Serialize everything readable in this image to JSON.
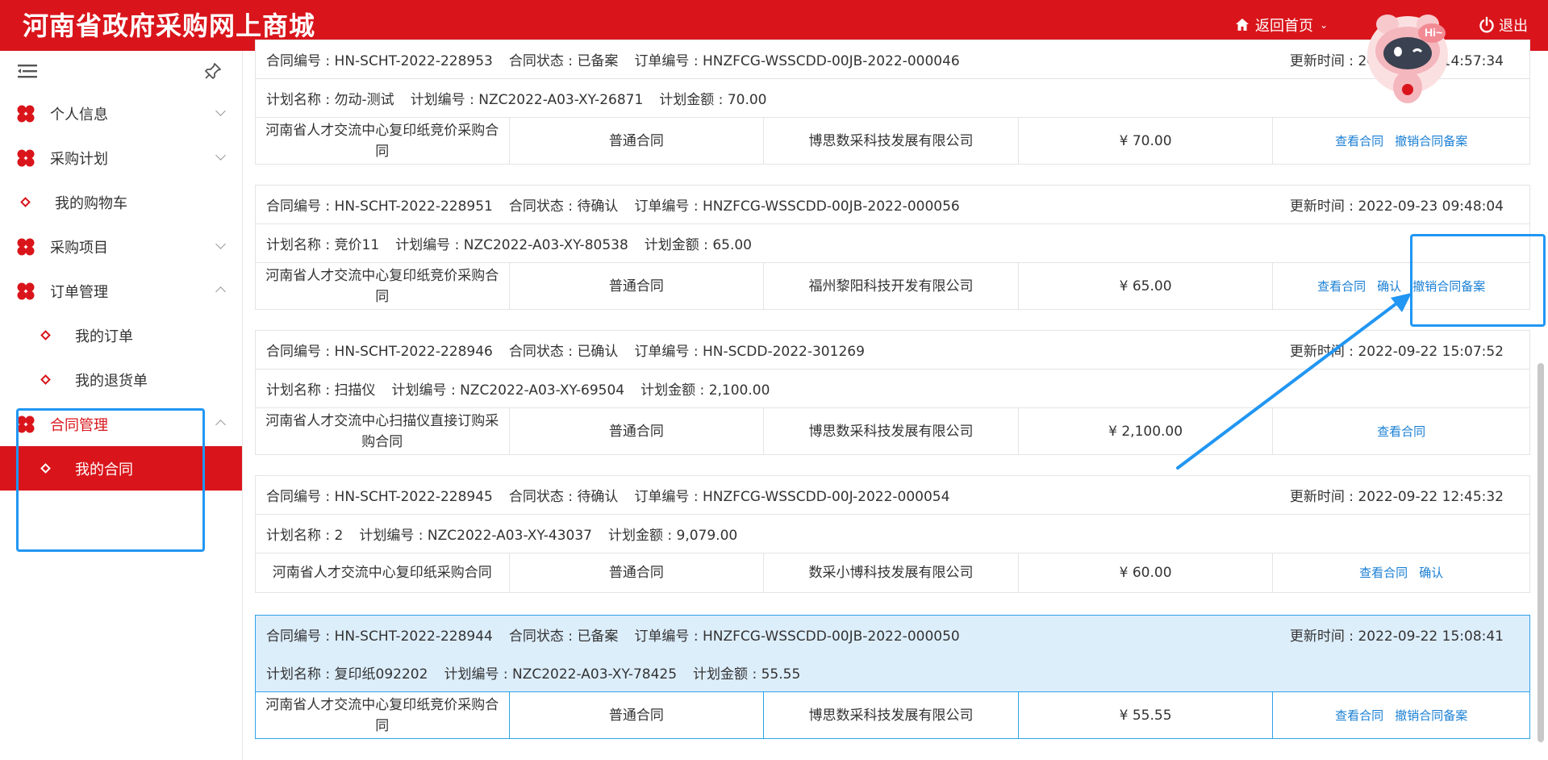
{
  "header": {
    "brand": "河南省政府采购网上商城",
    "home_label": "返回首页",
    "logout_label": "退出",
    "mascot_bubble": "Hi~"
  },
  "sidebar": {
    "items": [
      {
        "label": "个人信息"
      },
      {
        "label": "采购计划"
      },
      {
        "label": "我的购物车"
      },
      {
        "label": "采购项目"
      },
      {
        "label": "订单管理"
      },
      {
        "label": "我的订单"
      },
      {
        "label": "我的退货单"
      },
      {
        "label": "合同管理"
      },
      {
        "label": "我的合同"
      }
    ]
  },
  "labels": {
    "contract_no": "合同编号 : ",
    "contract_status": "合同状态 : ",
    "order_no": "订单编号 : ",
    "update_time": "更新时间 : ",
    "plan_name": "计划名称 : ",
    "plan_no": "计划编号 : ",
    "plan_amount": "计划金额 : "
  },
  "contracts": [
    {
      "contract_no": "HN-SCHT-2022-228953",
      "status": "已备案",
      "order_no": "HNZFCG-WSSCDD-00JB-2022-000046",
      "update_time": "2022-09-23 14:57:34",
      "plan_name": "勿动-测试",
      "plan_no": "NZC2022-A03-XY-26871",
      "plan_amount": "70.00",
      "name": "河南省人才交流中心复印纸竞价采购合同",
      "type": "普通合同",
      "supplier": "博思数采科技发展有限公司",
      "amount": "¥ 70.00",
      "actions": [
        "查看合同",
        "撤销合同备案"
      ]
    },
    {
      "contract_no": "HN-SCHT-2022-228951",
      "status": "待确认",
      "order_no": "HNZFCG-WSSCDD-00JB-2022-000056",
      "update_time": "2022-09-23 09:48:04",
      "plan_name": "竞价11",
      "plan_no": "NZC2022-A03-XY-80538",
      "plan_amount": "65.00",
      "name": "河南省人才交流中心复印纸竞价采购合同",
      "type": "普通合同",
      "supplier": "福州黎阳科技开发有限公司",
      "amount": "¥ 65.00",
      "actions": [
        "查看合同",
        "确认",
        "撤销合同备案"
      ]
    },
    {
      "contract_no": "HN-SCHT-2022-228946",
      "status": "已确认",
      "order_no": "HN-SCDD-2022-301269",
      "update_time": "2022-09-22 15:07:52",
      "plan_name": "扫描仪",
      "plan_no": "NZC2022-A03-XY-69504",
      "plan_amount": "2,100.00",
      "name": "河南省人才交流中心扫描仪直接订购采购合同",
      "type": "普通合同",
      "supplier": "博思数采科技发展有限公司",
      "amount": "¥ 2,100.00",
      "actions": [
        "查看合同"
      ]
    },
    {
      "contract_no": "HN-SCHT-2022-228945",
      "status": "待确认",
      "order_no": "HNZFCG-WSSCDD-00J-2022-000054",
      "update_time": "2022-09-22 12:45:32",
      "plan_name": "2",
      "plan_no": "NZC2022-A03-XY-43037",
      "plan_amount": "9,079.00",
      "name": "河南省人才交流中心复印纸采购合同",
      "type": "普通合同",
      "supplier": "数采小博科技发展有限公司",
      "amount": "¥ 60.00",
      "actions": [
        "查看合同",
        "确认"
      ]
    },
    {
      "contract_no": "HN-SCHT-2022-228944",
      "status": "已备案",
      "order_no": "HNZFCG-WSSCDD-00JB-2022-000050",
      "update_time": "2022-09-22 15:08:41",
      "plan_name": "复印纸092202",
      "plan_no": "NZC2022-A03-XY-78425",
      "plan_amount": "55.55",
      "name": "河南省人才交流中心复印纸竞价采购合同",
      "type": "普通合同",
      "supplier": "博思数采科技发展有限公司",
      "amount": "¥ 55.55",
      "actions": [
        "查看合同",
        "撤销合同备案"
      ]
    }
  ],
  "colors": {
    "brand_red": "#d9151b",
    "link_blue": "#1a7fd4",
    "annotation_blue": "#2196f3",
    "highlight_row": "#ddeefb"
  }
}
